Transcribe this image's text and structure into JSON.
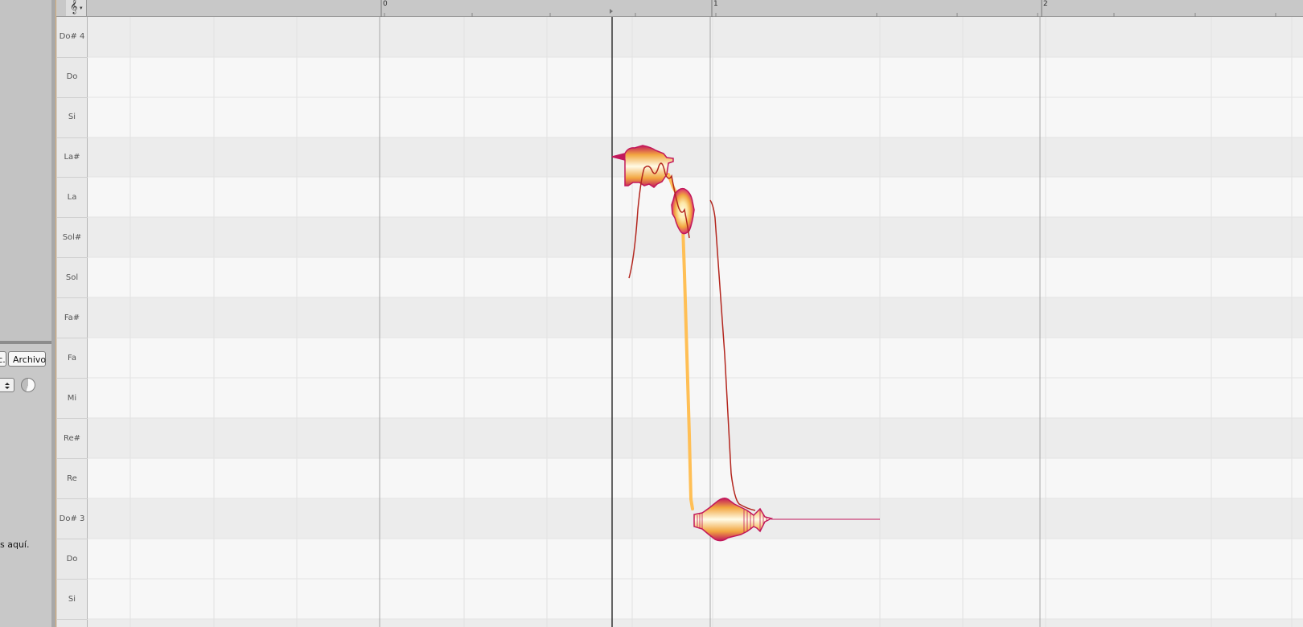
{
  "left_panel": {
    "cut_button_label": "c.",
    "file_button_label": "Archivo",
    "hint_text": "s aquí."
  },
  "toolbar": {
    "clef_icon": "treble-clef-icon",
    "clef_dropdown_icon": "chevron-down-icon"
  },
  "timeline": {
    "markers": [
      "0",
      "1",
      "2"
    ]
  },
  "piano_roll": {
    "pitch_labels": [
      "Do# 4",
      "Do",
      "Si",
      "La#",
      "La",
      "Sol#",
      "Sol",
      "Fa#",
      "Fa",
      "Mi",
      "Re#",
      "Re",
      "Do# 3",
      "Do",
      "Si"
    ],
    "playhead_position_beats": 0.7,
    "blob_colors": {
      "outer": "#c2185b",
      "mid": "#f2a640",
      "inner": "#fff3c4"
    },
    "pitch_curve_color": "#b3261e",
    "connector_color": "#ffbf55"
  }
}
